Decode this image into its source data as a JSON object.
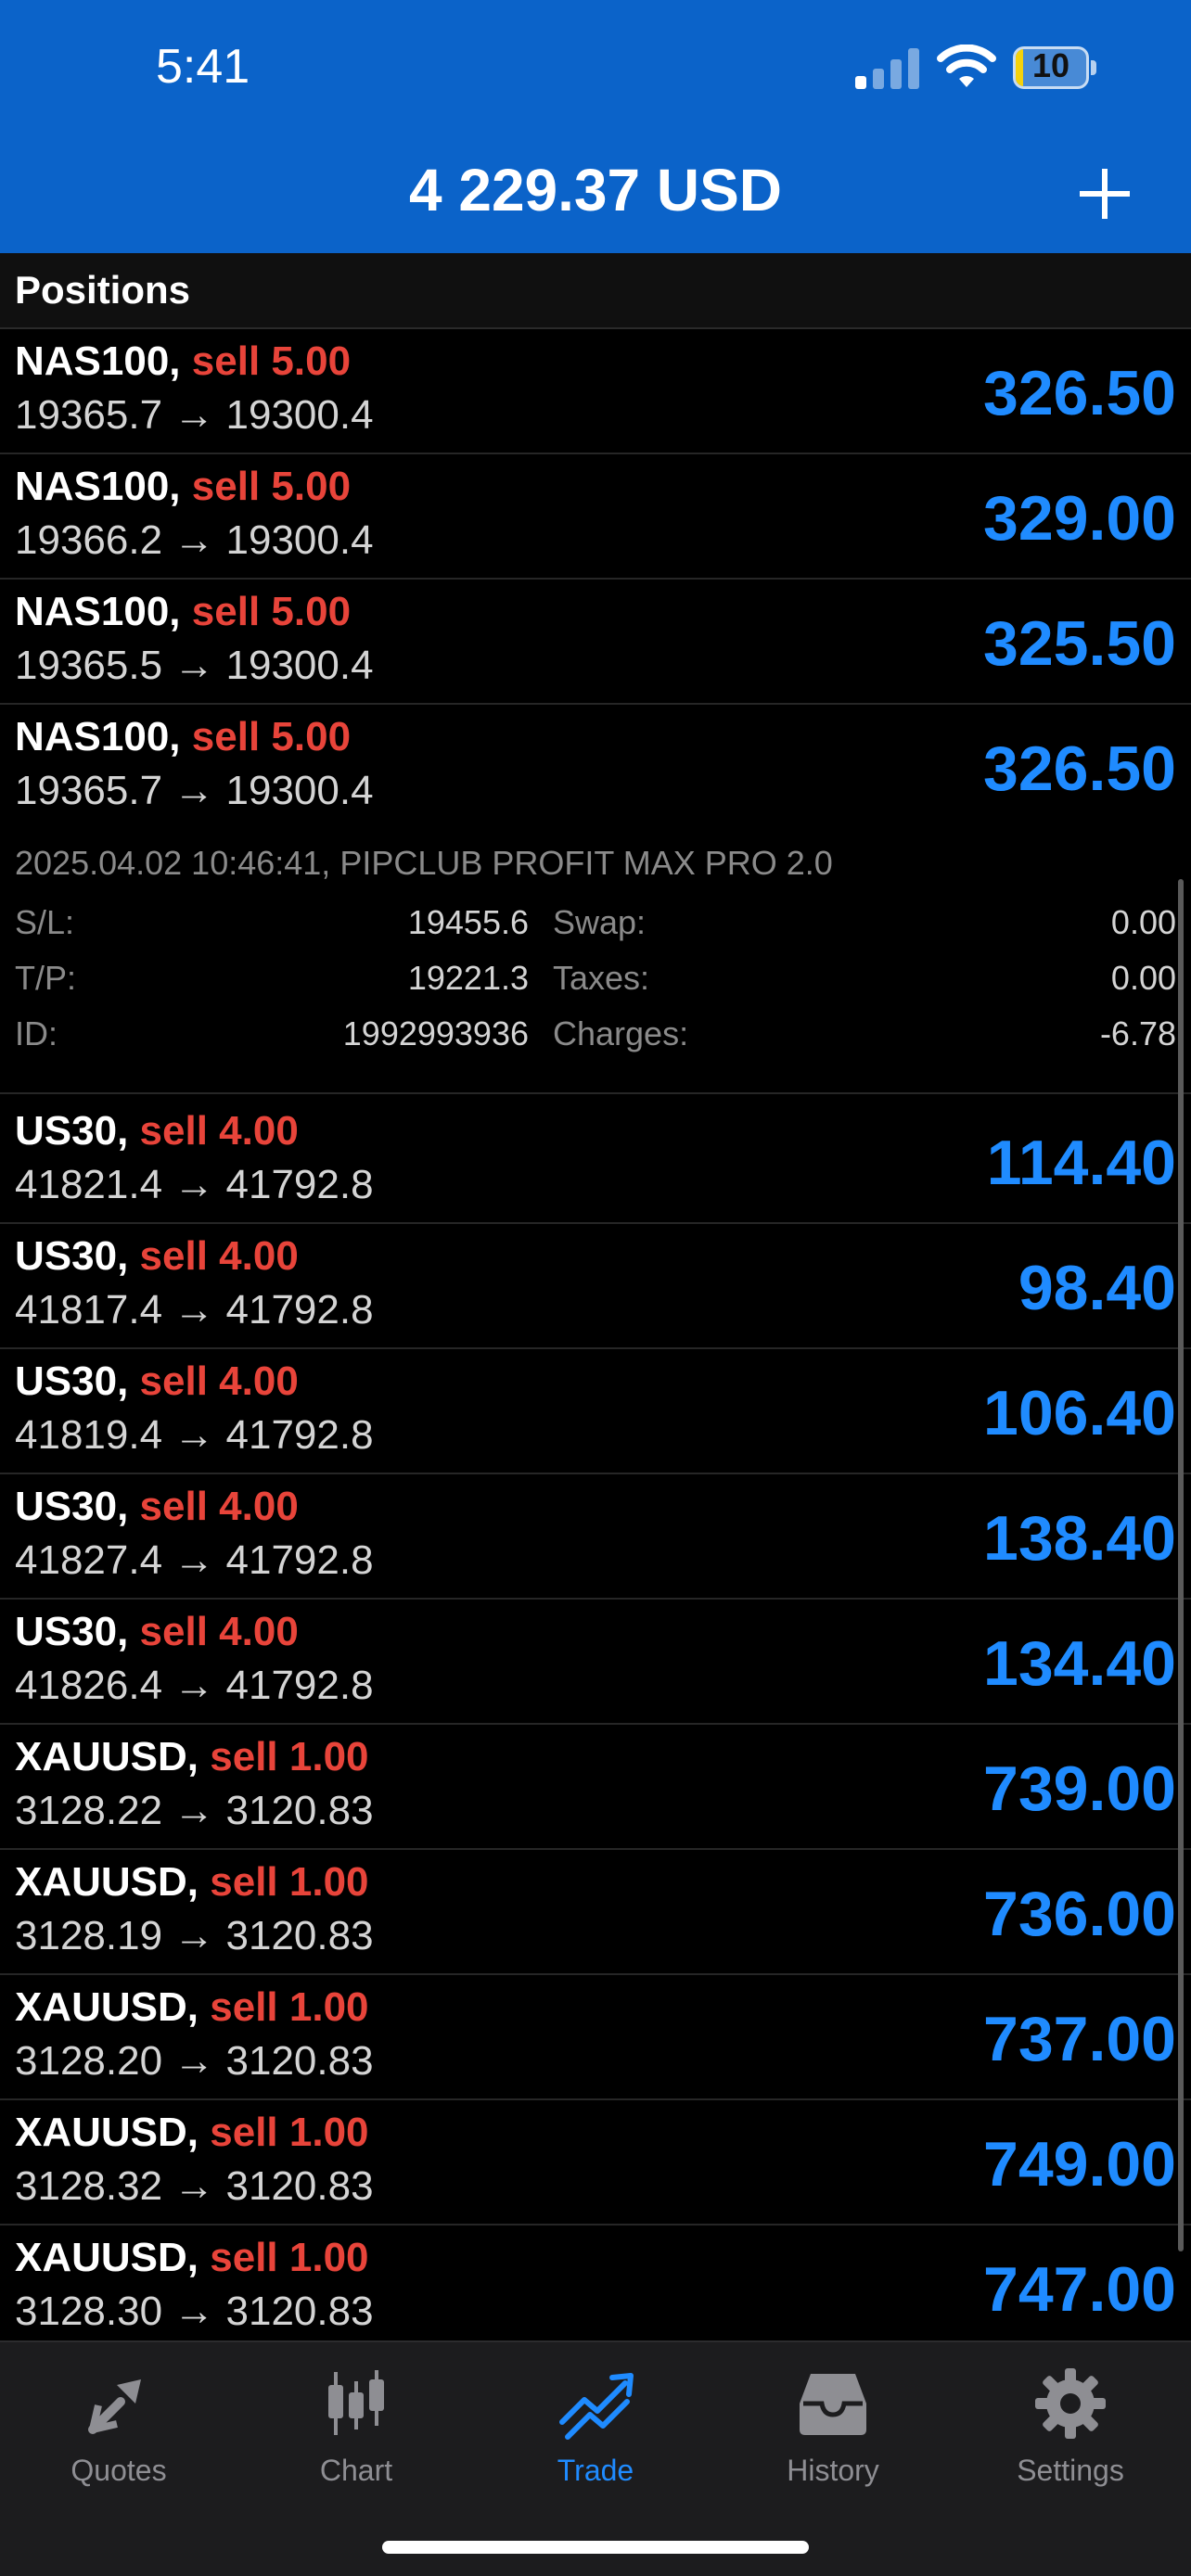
{
  "status_bar": {
    "time": "5:41",
    "battery": "10",
    "battery_level_percent": 10
  },
  "header": {
    "balance": "4 229.37 USD",
    "add_icon": "plus-icon"
  },
  "section": {
    "title": "Positions"
  },
  "positions": [
    {
      "symbol": "NAS100,",
      "side": "sell 5.00",
      "prices": "19365.7 → 19300.4",
      "profit": "326.50"
    },
    {
      "symbol": "NAS100,",
      "side": "sell 5.00",
      "prices": "19366.2 → 19300.4",
      "profit": "329.00"
    },
    {
      "symbol": "NAS100,",
      "side": "sell 5.00",
      "prices": "19365.5 → 19300.4",
      "profit": "325.50"
    },
    {
      "symbol": "NAS100,",
      "side": "sell 5.00",
      "prices": "19365.7 → 19300.4",
      "profit": "326.50"
    },
    {
      "symbol": "US30,",
      "side": "sell 4.00",
      "prices": "41821.4 → 41792.8",
      "profit": "114.40"
    },
    {
      "symbol": "US30,",
      "side": "sell 4.00",
      "prices": "41817.4 → 41792.8",
      "profit": "98.40"
    },
    {
      "symbol": "US30,",
      "side": "sell 4.00",
      "prices": "41819.4 → 41792.8",
      "profit": "106.40"
    },
    {
      "symbol": "US30,",
      "side": "sell 4.00",
      "prices": "41827.4 → 41792.8",
      "profit": "138.40"
    },
    {
      "symbol": "US30,",
      "side": "sell 4.00",
      "prices": "41826.4 → 41792.8",
      "profit": "134.40"
    },
    {
      "symbol": "XAUUSD,",
      "side": "sell 1.00",
      "prices": "3128.22 → 3120.83",
      "profit": "739.00"
    },
    {
      "symbol": "XAUUSD,",
      "side": "sell 1.00",
      "prices": "3128.19 → 3120.83",
      "profit": "736.00"
    },
    {
      "symbol": "XAUUSD,",
      "side": "sell 1.00",
      "prices": "3128.20 → 3120.83",
      "profit": "737.00"
    },
    {
      "symbol": "XAUUSD,",
      "side": "sell 1.00",
      "prices": "3128.32 → 3120.83",
      "profit": "749.00"
    },
    {
      "symbol": "XAUUSD,",
      "side": "sell 1.00",
      "prices": "3128.30 → 3120.83",
      "profit": "747.00"
    }
  ],
  "details": {
    "meta": "2025.04.02 10:46:41, PIPCLUB PROFIT MAX PRO 2.0",
    "sl_label": "S/L:",
    "sl_value": "19455.6",
    "tp_label": "T/P:",
    "tp_value": "19221.3",
    "id_label": "ID:",
    "id_value": "1992993936",
    "swap_label": "Swap:",
    "swap_value": "0.00",
    "taxes_label": "Taxes:",
    "taxes_value": "0.00",
    "charges_label": "Charges:",
    "charges_value": "-6.78"
  },
  "tabs": [
    {
      "label": "Quotes",
      "icon": "quotes-icon"
    },
    {
      "label": "Chart",
      "icon": "chart-icon"
    },
    {
      "label": "Trade",
      "icon": "trade-icon",
      "active": true
    },
    {
      "label": "History",
      "icon": "history-icon"
    },
    {
      "label": "Settings",
      "icon": "settings-icon"
    }
  ],
  "colors": {
    "header_bg": "#0b63c9",
    "profit": "#1f8bff",
    "sell": "#e8443a",
    "background": "#000000"
  }
}
